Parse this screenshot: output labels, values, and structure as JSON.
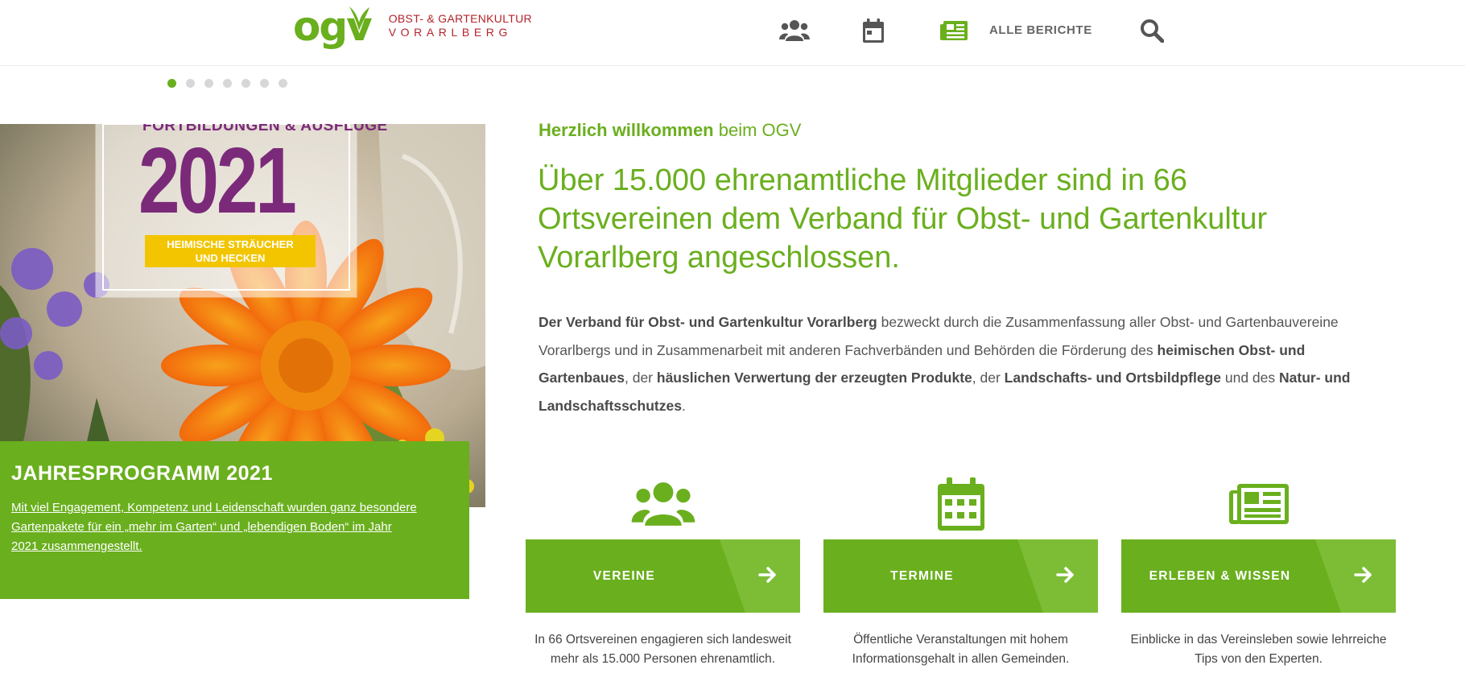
{
  "header": {
    "logo_mark": "ogv",
    "logo_line1": "OBST- & GARTENKULTUR",
    "logo_line2": "VORARLBERG",
    "nav_all_reports": "ALLE BERICHTE",
    "icons": [
      "users-icon",
      "calendar-icon",
      "newspaper-icon",
      "search-icon"
    ]
  },
  "slider": {
    "dot_count": 7,
    "active_index": 0
  },
  "hero": {
    "poster_top": "FORTBILDUNGEN & AUSFLÜGE",
    "poster_year": "2021",
    "poster_banner_1": "HEIMISCHE STRÄUCHER",
    "poster_banner_2": "UND HECKEN",
    "card_title": "JAHRESPROGRAMM 2021",
    "card_text": "Mit viel Engagement, Kompetenz und Leidenschaft wurden ganz besondere Gartenpakete für ein „mehr im Garten“ und „lebendigen Boden“ im Jahr 2021 zusammengestellt."
  },
  "welcome": {
    "bold": "Herzlich willkommen",
    "rest": " beim OGV"
  },
  "headline": "Über 15.000 ehrenamtliche Mitglieder sind in 66 Ortsvereinen dem Verband für Obst- und Gartenkultur Vorarlberg angeschlossen.",
  "intro": {
    "p1_bold": "Der Verband für Obst- und Gartenkultur Vorarlberg",
    "p1": " bezweckt durch die Zusammenfassung aller Obst- und Gartenbauvereine Vorarlbergs und in Zusammenarbeit mit anderen Fachverbänden und Behörden die Förderung des ",
    "p2_bold": "heimischen Obst- und Gartenbaues",
    "p2": ", der ",
    "p3_bold": "häuslichen Verwertung der erzeugten Produkte",
    "p3": ", der ",
    "p4_bold": "Landschafts- und Ortsbildpflege",
    "p4": " und des ",
    "p5_bold": "Natur- und Landschaftsschutzes",
    "p5": "."
  },
  "features": [
    {
      "label": "VEREINE",
      "desc": "In 66 Ortsvereinen engagieren sich landesweit mehr als 15.000 Personen ehrenamtlich.",
      "icon": "users-icon"
    },
    {
      "label": "TERMINE",
      "desc": "Öffentliche Veranstaltungen mit hohem Informationsgehalt in allen Gemeinden.",
      "icon": "calendar-icon"
    },
    {
      "label": "ERLEBEN & WISSEN",
      "desc": "Einblicke in das Vereinsleben sowie lehrreiche Tips von den Experten.",
      "icon": "newspaper-icon"
    }
  ],
  "colors": {
    "brand_green": "#6aaf1e",
    "stripe_green": "#7dbd35",
    "logo_red": "#b3242b",
    "poster_purple": "#7b2a7a",
    "poster_yellow": "#f2c500"
  }
}
